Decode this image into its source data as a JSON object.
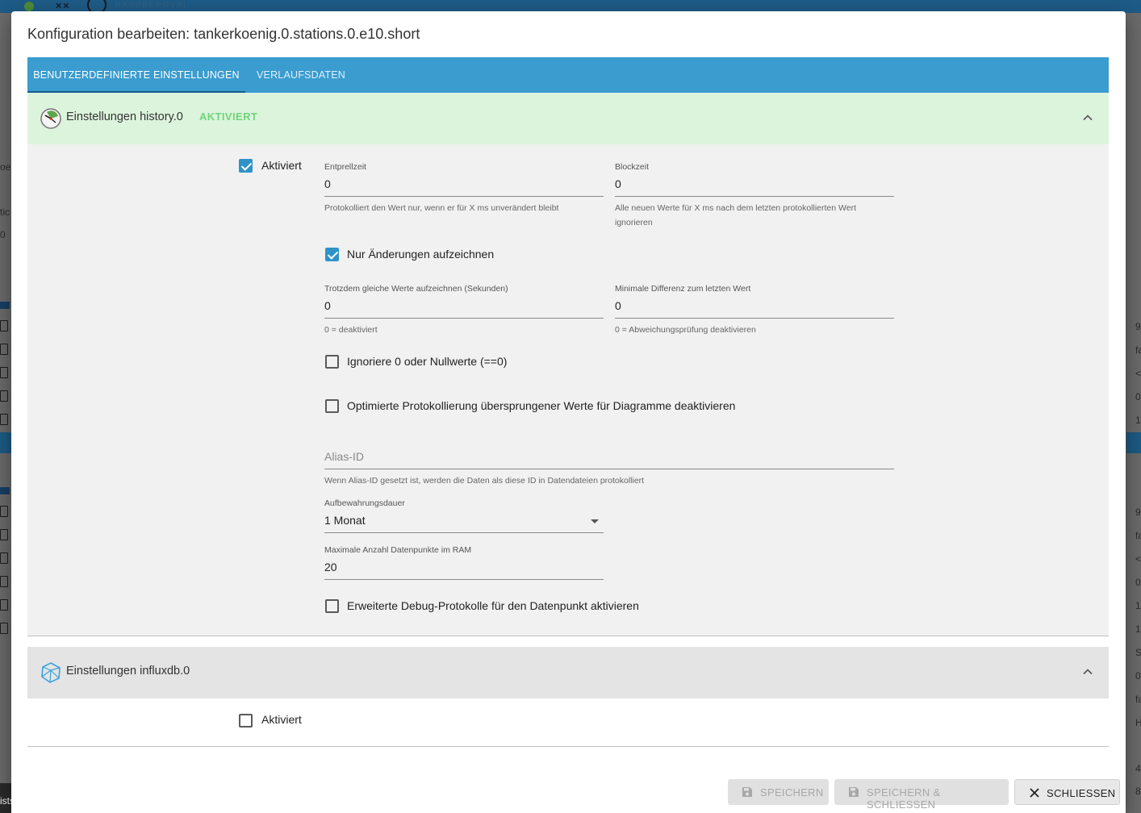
{
  "background": {
    "topbar_text": "RASPBERRYPI",
    "left_fragments": [
      "oe",
      "tic",
      "0",
      "c",
      "e"
    ],
    "right_values": [
      "9",
      "fa",
      "<",
      "0",
      "1",
      "1",
      "9",
      "fa",
      "<",
      "0",
      "1",
      "1",
      "S",
      "0",
      "fa",
      "H",
      "4",
      "8"
    ],
    "toast_text": "ists"
  },
  "dialog": {
    "title": "Konfiguration bearbeiten: tankerkoenig.0.stations.0.e10.short",
    "tabs": [
      {
        "label": "BENUTZERDEFINIERTE EINSTELLUNGEN",
        "active": true
      },
      {
        "label": "VERLAUFSDATEN",
        "active": false
      }
    ],
    "history": {
      "title": "Einstellungen history.0",
      "status": "AKTIVIERT",
      "enabled_label": "Aktiviert",
      "enabled": true,
      "debounce": {
        "label": "Entprellzeit",
        "value": "0",
        "help": "Protokolliert den Wert nur, wenn er für X ms unverändert bleibt"
      },
      "blocktime": {
        "label": "Blockzeit",
        "value": "0",
        "help": "Alle neuen Werte für X ms nach dem letzten protokollierten Wert ignorieren"
      },
      "changes_only": {
        "label": "Nur Änderungen aufzeichnen",
        "checked": true
      },
      "changes_relog": {
        "label": "Trotzdem gleiche Werte aufzeichnen (Sekunden)",
        "value": "0",
        "help": "0 = deaktiviert"
      },
      "min_diff": {
        "label": "Minimale Differenz zum letzten Wert",
        "value": "0",
        "help": "0 = Abweichungsprüfung deaktivieren"
      },
      "ignore_zero": {
        "label": "Ignoriere 0 oder Nullwerte (==0)",
        "checked": false
      },
      "disable_skipped": {
        "label": "Optimierte Protokollierung übersprungener Werte für Diagramme deaktivieren",
        "checked": false
      },
      "alias": {
        "placeholder": "Alias-ID",
        "value": "",
        "help": "Wenn Alias-ID gesetzt ist, werden die Daten als diese ID in Datendateien protokolliert"
      },
      "retention": {
        "label": "Aufbewahrungsdauer",
        "value": "1 Monat"
      },
      "max_ram": {
        "label": "Maximale Anzahl Datenpunkte im RAM",
        "value": "20"
      },
      "debug": {
        "label": "Erweiterte Debug-Protokolle für den Datenpunkt aktivieren",
        "checked": false
      }
    },
    "influx": {
      "title": "Einstellungen influxdb.0",
      "enabled_label": "Aktiviert",
      "enabled": false
    },
    "buttons": {
      "save": "SPEICHERN",
      "save_close": "SPEICHERN & SCHLIESSEN",
      "close": "SCHLIESSEN"
    },
    "colors": {
      "tab_bar": "#3a9ccf",
      "active_header": "#dcf4dc",
      "status_green": "#6fd57a",
      "checkbox": "#2f93c8"
    }
  }
}
